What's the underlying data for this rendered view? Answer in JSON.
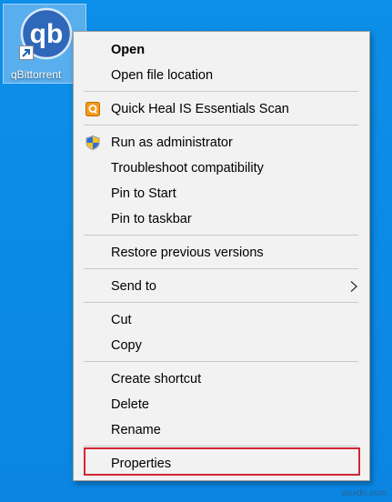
{
  "colors": {
    "desktop": "#0a8ae6",
    "menu_background": "#f2f2f2",
    "highlight": "#d32632"
  },
  "desktop": {
    "icon": {
      "logo_text": "qb",
      "label": "qBittorrent"
    }
  },
  "context_menu": {
    "items": {
      "open": "Open",
      "open_file_location": "Open file location",
      "quick_heal_scan": "Quick Heal IS Essentials Scan",
      "run_as_admin": "Run as administrator",
      "troubleshoot": "Troubleshoot compatibility",
      "pin_to_start": "Pin to Start",
      "pin_to_taskbar": "Pin to taskbar",
      "restore_previous": "Restore previous versions",
      "send_to": "Send to",
      "cut": "Cut",
      "copy": "Copy",
      "create_shortcut": "Create shortcut",
      "delete": "Delete",
      "rename": "Rename",
      "properties": "Properties"
    },
    "icons": {
      "quick_heal": "quick-heal-icon",
      "run_as_admin": "uac-shield-icon",
      "send_to": "chevron-right-icon"
    }
  },
  "watermark": "wsxdn.com"
}
